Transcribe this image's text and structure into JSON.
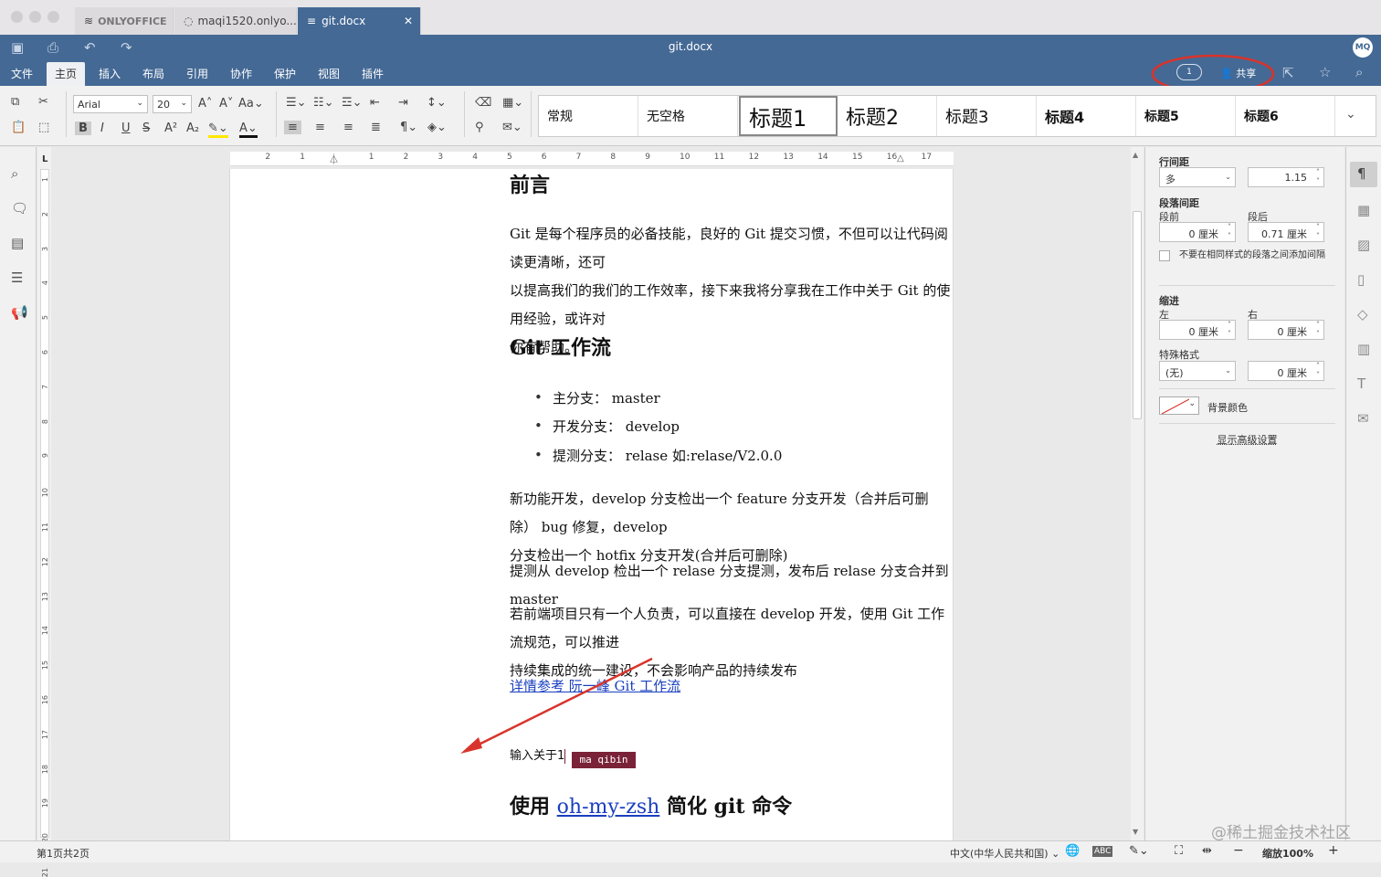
{
  "window": {
    "tabs": [
      {
        "label": "ONLYOFFICE"
      },
      {
        "label": "maqi1520.onlyo..."
      },
      {
        "label": "git.docx"
      }
    ]
  },
  "header": {
    "title": "git.docx",
    "avatar": "MQ",
    "coedit_count": "1",
    "share_label": "共享",
    "menus": [
      "文件",
      "主页",
      "插入",
      "布局",
      "引用",
      "协作",
      "保护",
      "视图",
      "插件"
    ],
    "active_menu": "主页"
  },
  "toolbar": {
    "font_name": "Arial",
    "font_size": "20",
    "styles": [
      "常规",
      "无空格",
      "标题1",
      "标题2",
      "标题3",
      "标题4",
      "标题5",
      "标题6"
    ]
  },
  "document": {
    "heading_preface": "前言",
    "para1": [
      "Git 是每个程序员的必备技能，良好的 Git 提交习惯，不但可以让代码阅读更清晰，还可",
      "以提高我们的我们的工作效率，接下来我将分享我在工作中关于 Git 的使用经验，或许对",
      "你有帮助。"
    ],
    "heading_workflow": "Git 工作流",
    "bullets": [
      "主分支： master",
      "开发分支： develop",
      "提测分支： relase 如:relase/V2.0.0"
    ],
    "para2": [
      "新功能开发，develop 分支检出一个 feature 分支开发（合并后可删除） bug 修复，develop",
      "分支检出一个 hotfix 分支开发(合并后可删除)"
    ],
    "para3": "提测从 develop 检出一个 relase 分支提测，发布后 relase 分支合并到 master",
    "para4": [
      "若前端项目只有一个人负责，可以直接在 develop 开发，使用 Git 工作流规范，可以推进",
      "持续集成的统一建设，不会影响产品的持续发布"
    ],
    "link": "详情参考 阮一峰 Git 工作流",
    "cursor_user": "ma qibin",
    "typing": "输入关于1",
    "heading_last_prefix": "使用 ",
    "heading_last_link": "oh-my-zsh",
    "heading_last_suffix": " 简化 git 命令"
  },
  "ruler": {
    "marks": [
      "2",
      "1",
      "1",
      "2",
      "3",
      "4",
      "5",
      "6",
      "7",
      "8",
      "9",
      "10",
      "11",
      "12",
      "13",
      "14",
      "15",
      "16",
      "17"
    ],
    "vmarks": [
      "1",
      "2",
      "3",
      "4",
      "5",
      "6",
      "7",
      "8",
      "9",
      "10",
      "11",
      "12",
      "13",
      "14",
      "15",
      "16",
      "17",
      "18",
      "19",
      "20",
      "21"
    ]
  },
  "paragraph_panel": {
    "line_spacing_label": "行间距",
    "line_spacing_type": "多",
    "line_spacing_value": "1.15",
    "para_spacing_label": "段落间距",
    "before_label": "段前",
    "before_value": "0 厘米",
    "after_label": "段后",
    "after_value": "0.71 厘米",
    "no_space_label": "不要在相同样式的段落之间添加间隔",
    "indent_label": "缩进",
    "left_label": "左",
    "left_value": "0 厘米",
    "right_label": "右",
    "right_value": "0 厘米",
    "special_label": "特殊格式",
    "special_value": "(无)",
    "special_size": "0 厘米",
    "bg_color_label": "背景颜色",
    "advanced_label": "显示高级设置"
  },
  "status": {
    "page_info": "第1页共2页",
    "language": "中文(中华人民共和国)",
    "zoom": "缩放100%",
    "watermark": "@稀土掘金技术社区"
  },
  "colors": {
    "header_bg": "#446995",
    "annotation_red": "#d9342b",
    "cursor_tag": "#7a2238",
    "link": "#1a3fbf"
  }
}
